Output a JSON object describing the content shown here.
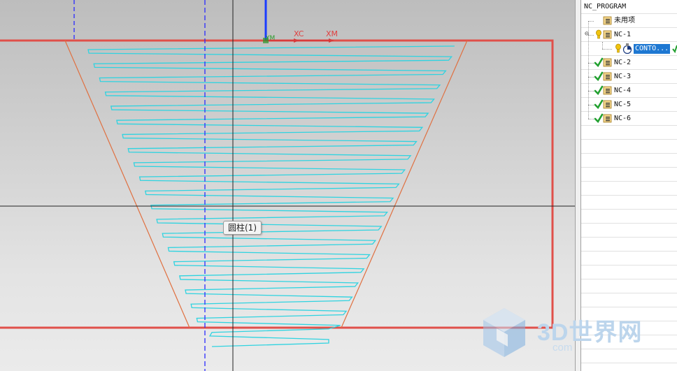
{
  "viewport": {
    "axis_labels": {
      "xc": "XC",
      "xm": "XM",
      "ym": "YM"
    },
    "tooltip": "圆柱(1)",
    "colors": {
      "boundary": "#e0504a",
      "wall": "#e07040",
      "toolpath": "#2fd3e0",
      "axis_blue": "#1a3cff",
      "crosshair": "#222222"
    }
  },
  "navigator": {
    "header": "NC_PROGRAM",
    "items": [
      {
        "label": "未用项",
        "icon": "folder-program-icon",
        "status": "none"
      },
      {
        "label": "NC-1",
        "icon": "folder-program-icon",
        "status": "needs-regenerate",
        "expanded": true,
        "toggle": "⊖"
      },
      {
        "label": "CONTO...",
        "icon": "contour-operation-icon",
        "status": "needs-regenerate",
        "selected": true
      },
      {
        "label": "NC-2",
        "icon": "folder-program-icon",
        "status": "complete"
      },
      {
        "label": "NC-3",
        "icon": "folder-program-icon",
        "status": "complete"
      },
      {
        "label": "NC-4",
        "icon": "folder-program-icon",
        "status": "complete"
      },
      {
        "label": "NC-5",
        "icon": "folder-program-icon",
        "status": "complete"
      },
      {
        "label": "NC-6",
        "icon": "folder-program-icon",
        "status": "complete"
      }
    ]
  },
  "watermark": {
    "text": "3D世界网",
    "subtext": "com"
  }
}
